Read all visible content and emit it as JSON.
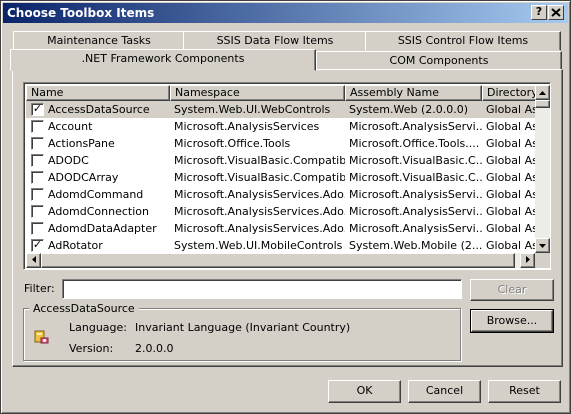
{
  "window": {
    "title": "Choose Toolbox Items",
    "help_button": "?",
    "close_button": "X"
  },
  "tabs": {
    "back_row": [
      "Maintenance Tasks",
      "SSIS Data Flow Items",
      "SSIS Control Flow Items"
    ],
    "front_row": [
      ".NET Framework Components",
      "COM Components"
    ],
    "active": ".NET Framework Components"
  },
  "list": {
    "columns": [
      "Name",
      "Namespace",
      "Assembly Name",
      "Directory"
    ],
    "rows": [
      {
        "checked": true,
        "name": "AccessDataSource",
        "namespace": "System.Web.UI.WebControls",
        "assembly": "System.Web (2.0.0.0)",
        "directory": "Global Ass"
      },
      {
        "checked": false,
        "name": "Account",
        "namespace": "Microsoft.AnalysisServices",
        "assembly": "Microsoft.AnalysisServi...",
        "directory": "Global Ass"
      },
      {
        "checked": false,
        "name": "ActionsPane",
        "namespace": "Microsoft.Office.Tools",
        "assembly": "Microsoft.Office.Tools....",
        "directory": "Global Ass"
      },
      {
        "checked": false,
        "name": "ADODC",
        "namespace": "Microsoft.VisualBasic.Compatibi...",
        "assembly": "Microsoft.VisualBasic.C...",
        "directory": "Global Ass"
      },
      {
        "checked": false,
        "name": "ADODCArray",
        "namespace": "Microsoft.VisualBasic.Compatibi...",
        "assembly": "Microsoft.VisualBasic.C...",
        "directory": "Global Ass"
      },
      {
        "checked": false,
        "name": "AdomdCommand",
        "namespace": "Microsoft.AnalysisServices.Ado...",
        "assembly": "Microsoft.AnalysisServi...",
        "directory": "Global Ass"
      },
      {
        "checked": false,
        "name": "AdomdConnection",
        "namespace": "Microsoft.AnalysisServices.Ado...",
        "assembly": "Microsoft.AnalysisServi...",
        "directory": "Global Ass"
      },
      {
        "checked": false,
        "name": "AdomdDataAdapter",
        "namespace": "Microsoft.AnalysisServices.Ado...",
        "assembly": "Microsoft.AnalysisServi...",
        "directory": "Global Ass"
      },
      {
        "checked": true,
        "name": "AdRotator",
        "namespace": "System.Web.UI.MobileControls",
        "assembly": "System.Web.Mobile (2....",
        "directory": "Global Ass"
      }
    ],
    "selected_index": 0
  },
  "filter": {
    "label": "Filter:",
    "value": "",
    "clear_label": "Clear"
  },
  "details": {
    "title": "AccessDataSource",
    "language_label": "Language:",
    "language_value": "Invariant Language (Invariant Country)",
    "version_label": "Version:",
    "version_value": "2.0.0.0",
    "browse_label": "Browse..."
  },
  "buttons": {
    "ok": "OK",
    "cancel": "Cancel",
    "reset": "Reset"
  },
  "colors": {
    "title_start": "#0a246a",
    "title_end": "#a6caf0",
    "face": "#d4d0c8"
  }
}
